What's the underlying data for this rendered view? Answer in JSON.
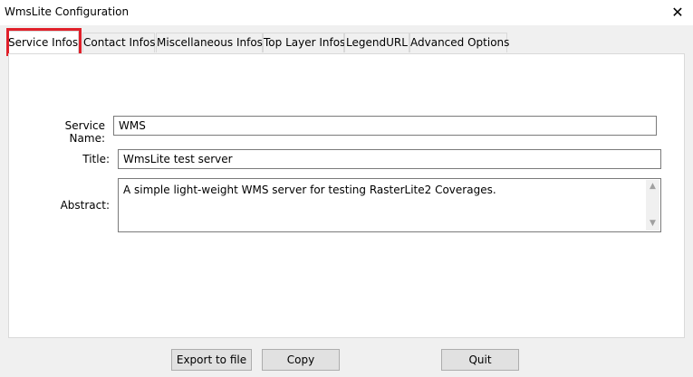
{
  "window": {
    "title": "WmsLite Configuration",
    "close_icon": "close-icon"
  },
  "tabs": [
    {
      "label": "Service Infos",
      "active": true
    },
    {
      "label": "Contact Infos",
      "active": false
    },
    {
      "label": "Miscellaneous Infos",
      "active": false
    },
    {
      "label": "Top Layer Infos",
      "active": false
    },
    {
      "label": "LegendURL",
      "active": false
    },
    {
      "label": "Advanced Options",
      "active": false
    }
  ],
  "form": {
    "service_name": {
      "label": "Service Name:",
      "value": "WMS"
    },
    "title": {
      "label": "Title:",
      "value": "WmsLite test server"
    },
    "abstract": {
      "label": "Abstract:",
      "value": "A simple light-weight WMS server for testing RasterLite2 Coverages."
    }
  },
  "buttons": {
    "export": "Export to file",
    "copy": "Copy",
    "quit": "Quit"
  },
  "colors": {
    "highlight": "#e0202a",
    "panel": "#ffffff",
    "window": "#f0f0f0"
  }
}
